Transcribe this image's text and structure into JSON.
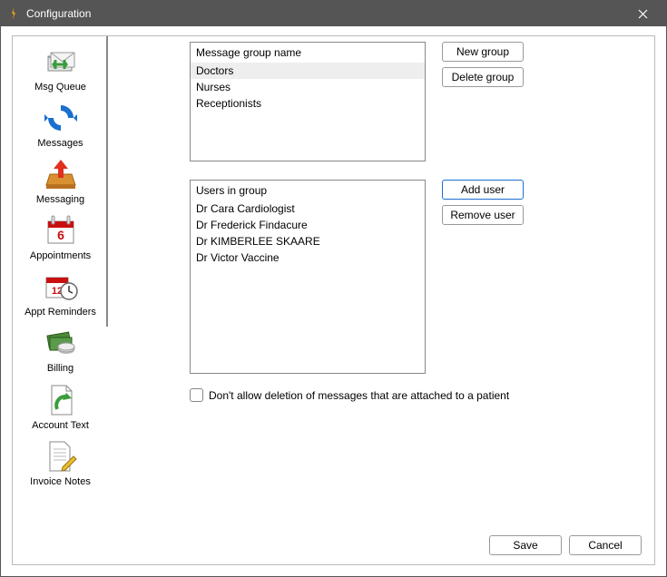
{
  "window": {
    "title": "Configuration"
  },
  "sidebar": {
    "items": [
      {
        "label": "Msg Queue"
      },
      {
        "label": "Messages"
      },
      {
        "label": "Messaging"
      },
      {
        "label": "Appointments"
      },
      {
        "label": "Appt Reminders"
      },
      {
        "label": "Billing"
      },
      {
        "label": "Account Text"
      },
      {
        "label": "Invoice Notes"
      }
    ]
  },
  "groups": {
    "header": "Message group name",
    "items": [
      "Doctors",
      "Nurses",
      "Receptionists"
    ],
    "selected_index": 0,
    "buttons": {
      "new": "New group",
      "delete": "Delete group"
    }
  },
  "users": {
    "header": "Users in group",
    "items": [
      "Dr Cara Cardiologist",
      "Dr Frederick Findacure",
      "Dr KIMBERLEE SKAARE",
      "Dr Victor Vaccine"
    ],
    "buttons": {
      "add": "Add user",
      "remove": "Remove user"
    }
  },
  "options": {
    "dont_allow_delete": "Don't allow deletion of messages that are attached to a patient"
  },
  "footer": {
    "save": "Save",
    "cancel": "Cancel"
  }
}
